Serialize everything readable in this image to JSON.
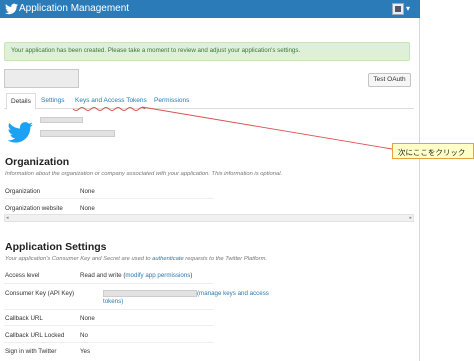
{
  "header": {
    "title": "Application Management",
    "logo_icon": "twitter-bird-icon",
    "user_menu_caret": "▾",
    "bar_color": "#2b7bb9"
  },
  "alert": {
    "text": "Your application has been created. Please take a moment to review and adjust your application's settings.",
    "color": "#dff0d8"
  },
  "actions": {
    "test_oauth_label": "Test OAuth"
  },
  "tabs": [
    {
      "label": "Details",
      "active": true
    },
    {
      "label": "Settings",
      "active": false
    },
    {
      "label": "Keys and Access Tokens",
      "active": false
    },
    {
      "label": "Permissions",
      "active": false
    }
  ],
  "organization": {
    "heading": "Organization",
    "description": "Information about the organization or company associated with your application. This information is optional.",
    "rows": [
      {
        "label": "Organization",
        "value": "None"
      },
      {
        "label": "Organization website",
        "value": "None"
      }
    ]
  },
  "scrollbar": {
    "left_arrow": "◂",
    "right_arrow": "▸"
  },
  "app_settings": {
    "heading": "Application Settings",
    "desc_prefix": "Your application's Consumer Key and Secret are used to ",
    "desc_link": "authenticate",
    "desc_suffix": " requests to the Twitter Platform.",
    "access_level": {
      "label": "Access level",
      "value": "Read and write (",
      "link": "modify app permissions",
      "value_end": ")"
    },
    "consumer_key": {
      "label": "Consumer Key (API Key)",
      "link_line1": "(manage keys and access",
      "link_line2": "tokens)"
    },
    "rows": [
      {
        "label": "Callback URL",
        "value": "None"
      },
      {
        "label": "Callback URL Locked",
        "value": "No"
      },
      {
        "label": "Sign in with Twitter",
        "value": "Yes"
      }
    ]
  },
  "annotation": {
    "callout_text": "次にここをクリック",
    "callout_bg": "#ffffc8",
    "callout_border": "#e6a23c"
  }
}
